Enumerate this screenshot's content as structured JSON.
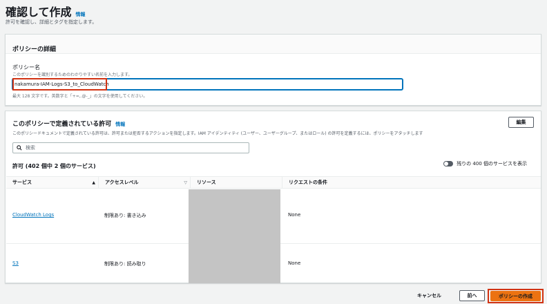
{
  "header": {
    "title": "確認して作成",
    "info_label": "情報",
    "subtitle": "許可を確認し、詳細とタグを指定します。"
  },
  "policy_details": {
    "section_title": "ポリシーの詳細",
    "name_label": "ポリシー名",
    "name_description": "このポリシーを識別するためのわかりやすい名前を入力します。",
    "name_value": "nakamura-IAM-Logs-S3_to_CloudWatch",
    "name_constraint": "最大 128 文字です。英数字と「+=,.@-_」の文字を使用してください。"
  },
  "permissions": {
    "section_title": "このポリシーで定義されている許可",
    "info_label": "情報",
    "description": "このポリシードキュメントで定義されている許可は、許可または拒否するアクションを指定します。IAM アイデンティティ (ユーザー、ユーザーグループ、またはロール) の許可を定義するには、ポリシーをアタッチします",
    "edit_label": "編集",
    "search_placeholder": "検索",
    "count_label": "許可 (402 個中 2 個のサービス)",
    "toggle_label": "残りの 400 個のサービスを表示",
    "columns": {
      "service": "サービス",
      "access_level": "アクセスレベル",
      "resource": "リソース",
      "condition": "リクエストの条件"
    },
    "rows": [
      {
        "service": "CloudWatch Logs",
        "access_level": "制限あり: 書き込み",
        "condition": "None"
      },
      {
        "service": "S3",
        "access_level": "制限あり: 読み取り",
        "condition": "None"
      }
    ]
  },
  "footer": {
    "cancel_label": "キャンセル",
    "prev_label": "前へ",
    "create_label": "ポリシーの作成"
  },
  "colors": {
    "accent": "#0073bb",
    "primary_button": "#ec7211",
    "highlight": "#d13212"
  }
}
